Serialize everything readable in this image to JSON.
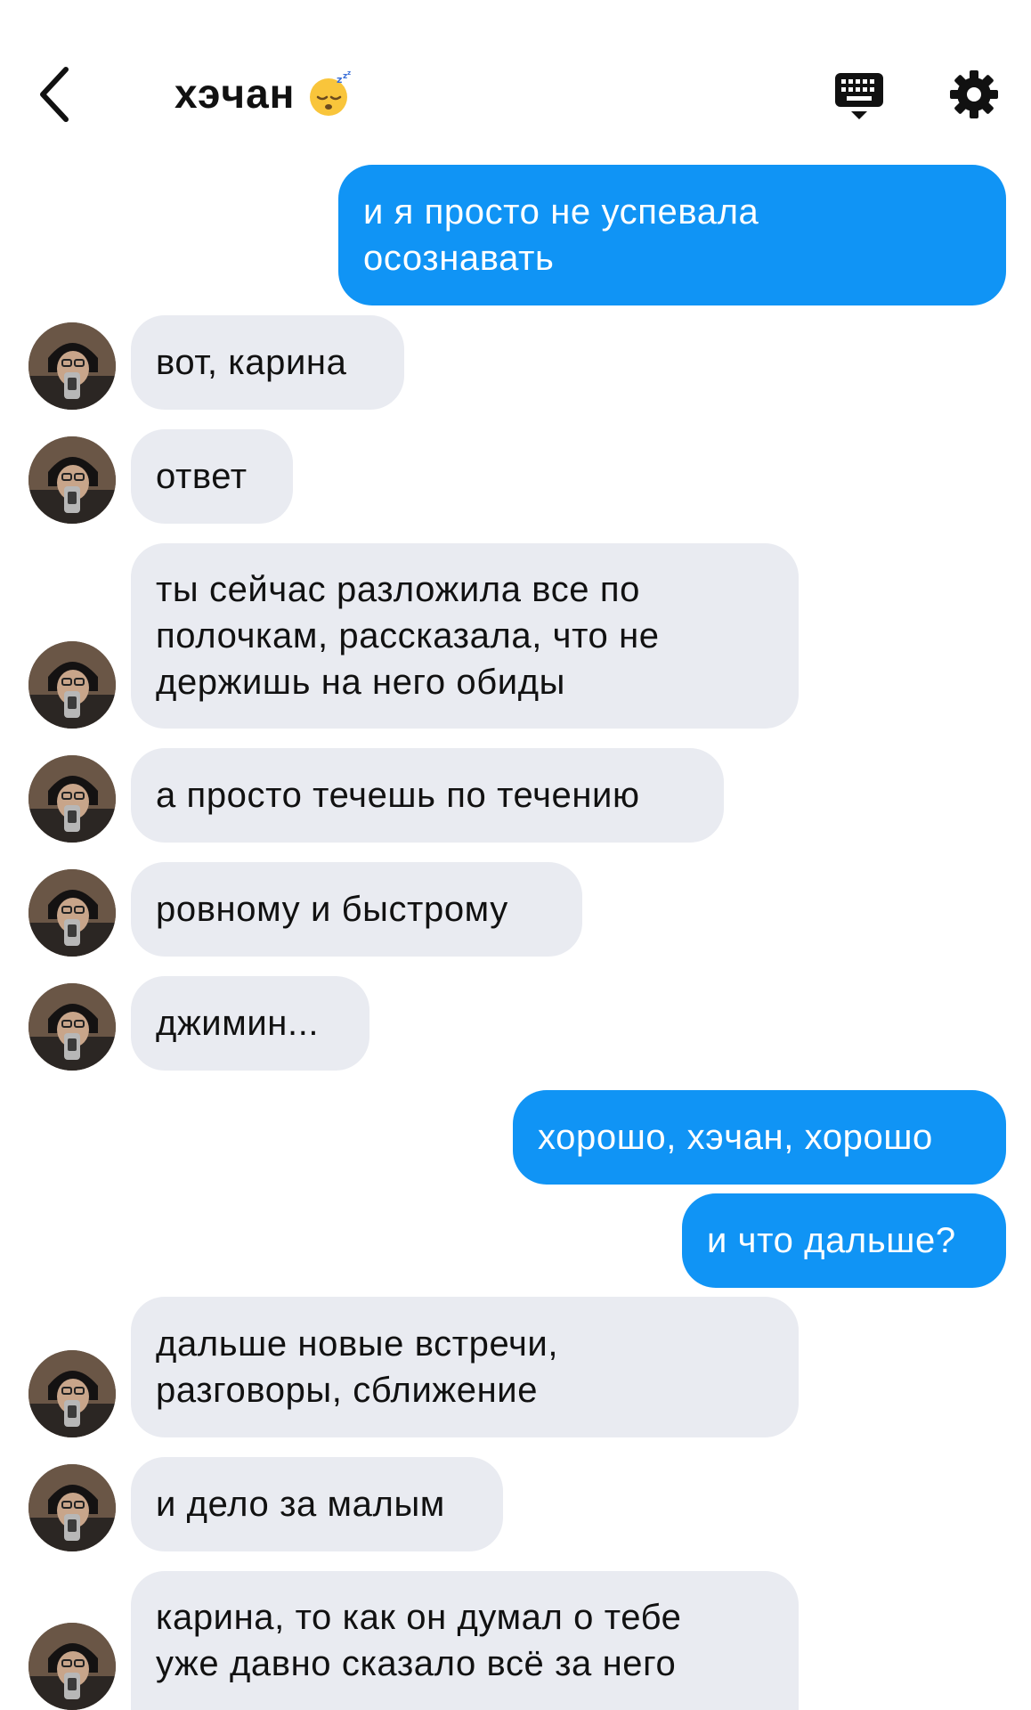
{
  "header": {
    "title": "хэчан",
    "title_emoji": "sleeping-face-emoji"
  },
  "colors": {
    "outgoing_bubble": "#1094f5",
    "incoming_bubble": "#e9ebf1",
    "text_dark": "#111111"
  },
  "messages": [
    {
      "side": "out",
      "text": "и я просто не успевала\nосознавать"
    },
    {
      "side": "in",
      "text": "вот, карина"
    },
    {
      "side": "in",
      "text": "ответ"
    },
    {
      "side": "in",
      "text": "ты сейчас разложила все по\nполочкам, рассказала, что не\nдержишь на него обиды"
    },
    {
      "side": "in",
      "text": "а просто течешь по течению"
    },
    {
      "side": "in",
      "text": "ровному и быстрому"
    },
    {
      "side": "in",
      "text": "джимин..."
    },
    {
      "side": "out",
      "text": "хорошо, хэчан, хорошо"
    },
    {
      "side": "out",
      "text": "и что дальше?"
    },
    {
      "side": "in",
      "text": "дальше новые встречи,\nразговоры, сближение"
    },
    {
      "side": "in",
      "text": "и дело за малым"
    },
    {
      "side": "in",
      "text": "карина, то как он думал о тебе\nуже давно сказало всё за него"
    }
  ]
}
